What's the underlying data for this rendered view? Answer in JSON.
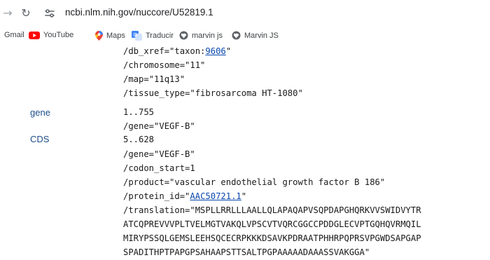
{
  "browser": {
    "url": "ncbi.nlm.nih.gov/nuccore/U52819.1",
    "bookmarks": [
      {
        "label": "Gmail",
        "icon": "none"
      },
      {
        "label": "YouTube",
        "icon": "youtube-icon"
      },
      {
        "label": "Maps",
        "icon": "maps-icon"
      },
      {
        "label": "Traducir",
        "icon": "translate-icon"
      },
      {
        "label": "marvin js",
        "icon": "globe-icon"
      },
      {
        "label": "Marvin JS",
        "icon": "globe-icon"
      }
    ]
  },
  "record": {
    "feature_keys": {
      "gene": "gene",
      "cds": "CDS"
    },
    "db_xref_prefix": "/db_xref=\"taxon:",
    "db_xref_link": "9606",
    "db_xref_suffix": "\"",
    "chromosome": "/chromosome=\"11\"",
    "map": "/map=\"11q13\"",
    "tissue_type": "/tissue_type=\"fibrosarcoma HT-1080\"",
    "gene_location": "1..755",
    "gene_qualifier": "/gene=\"VEGF-B\"",
    "cds_location": "5..628",
    "cds_gene_qualifier": "/gene=\"VEGF-B\"",
    "codon_start": "/codon_start=1",
    "product": "/product=\"vascular endothelial growth factor B 186\"",
    "protein_id_prefix": "/protein_id=\"",
    "protein_id_link": "AAC50721.1",
    "protein_id_suffix": "\"",
    "translation_lines": [
      "/translation=\"MSPLLRRLLLAALLQLAPAQAPVSQPDAPGHQRKVVSWIDVYTR",
      "ATCQPREVVVPLTVELMGTVAKQLVPSCVTVQRCGGCCPDDGLECVPTGQHQVRMQIL",
      "MIRYPSSQLGEMSLEEHSQCECRPKKKDSAVKPDRAATPHHRPQPRSVPGWDSAPGAP",
      "SPADITHPTPAPGPSAHAAPSTTSALTPGPAAAAADAAASSVAKGGA\""
    ]
  },
  "colors": {
    "link": "#0645ad",
    "feature_key": "#1d4e89",
    "youtube_red": "#ff0000"
  }
}
